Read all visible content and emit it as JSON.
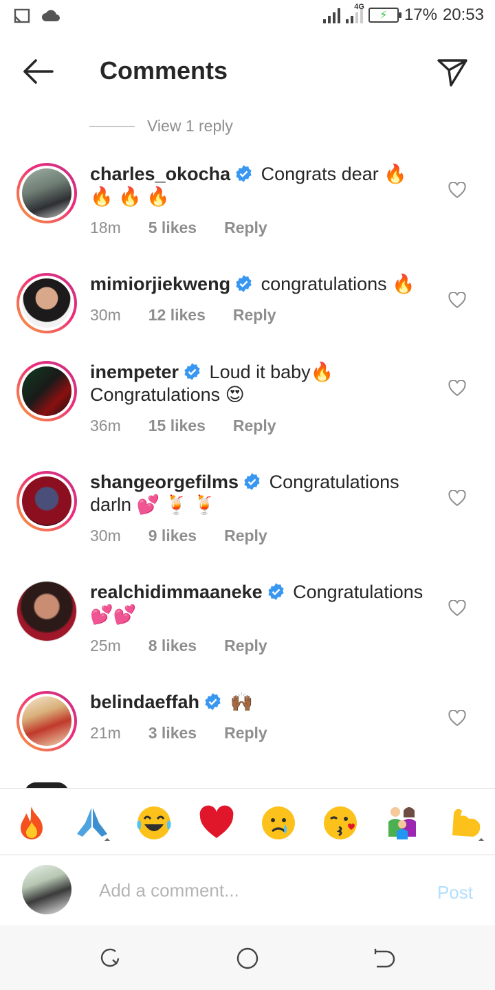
{
  "status_bar": {
    "network": "4G",
    "battery": "17%",
    "time": "20:53"
  },
  "header": {
    "title": "Comments"
  },
  "view_reply": {
    "label": "View 1 reply"
  },
  "comments": [
    {
      "username": "charles_okocha",
      "text": "Congrats dear 🔥 🔥 🔥 🔥",
      "time": "18m",
      "likes": "5 likes",
      "reply": "Reply"
    },
    {
      "username": "mimiorjiekweng",
      "text": "congratulations 🔥",
      "time": "30m",
      "likes": "12 likes",
      "reply": "Reply"
    },
    {
      "username": "inempeter",
      "text": "Loud it baby🔥 Congratulations 😍",
      "time": "36m",
      "likes": "15 likes",
      "reply": "Reply"
    },
    {
      "username": "shangeorgefilms",
      "text": "Congratulations darln 💕 🍹 🍹",
      "time": "30m",
      "likes": "9 likes",
      "reply": "Reply"
    },
    {
      "username": "realchidimmaaneke",
      "text": "Congratulations 💕💕",
      "time": "25m",
      "likes": "8 likes",
      "reply": "Reply"
    },
    {
      "username": "belindaeffah",
      "text": "🙌🏾",
      "time": "21m",
      "likes": "3 likes",
      "reply": "Reply"
    }
  ],
  "emoji_bar": [
    "🔥",
    "🙏",
    "😂",
    "❤️",
    "😢",
    "😘",
    "👨‍👩‍👦",
    "💪"
  ],
  "comment_input": {
    "placeholder": "Add a comment...",
    "post_label": "Post"
  },
  "colors": {
    "accent": "#3897f0",
    "post_disabled": "#b2dffc",
    "muted": "#8e8e8e"
  }
}
